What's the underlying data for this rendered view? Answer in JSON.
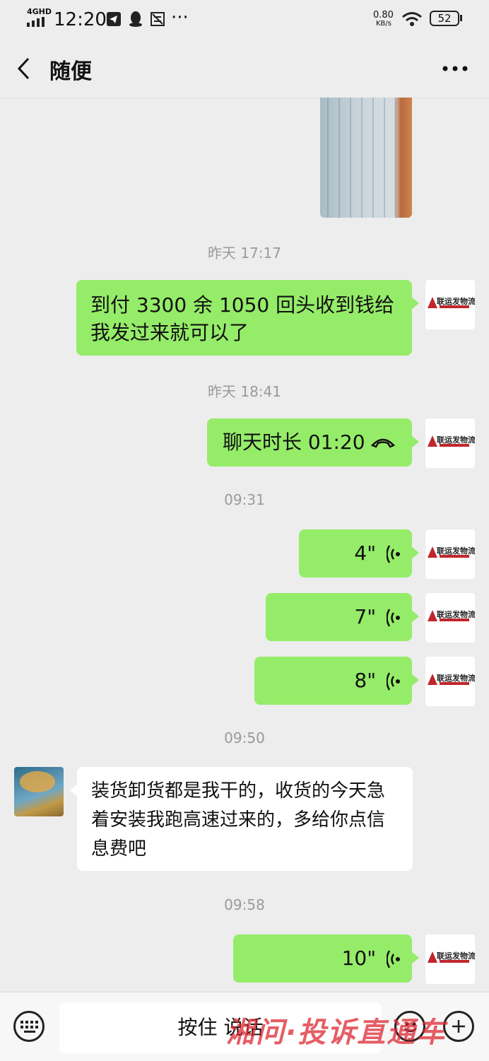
{
  "status_bar": {
    "network": "4GHD",
    "time": "12:20",
    "speed_value": "0.80",
    "speed_unit": "KB/s",
    "battery": "52"
  },
  "header": {
    "title": "随便"
  },
  "messages": {
    "ts1": "昨天 17:17",
    "text1": "到付 3300 余 1050 回头收到钱给我发过来就可以了",
    "ts2": "昨天 18:41",
    "call": "聊天时长 01:20",
    "ts3": "09:31",
    "voice1": "4\"",
    "voice2": "7\"",
    "voice3": "8\"",
    "ts4": "09:50",
    "text2": "装货卸货都是我干的，收货的今天急着安装我跑高速过来的，多给你点信息费吧",
    "ts5": "09:58",
    "voice4": "10\""
  },
  "logo": {
    "name": "联运发物流"
  },
  "input_bar": {
    "hold_to_talk": "按住 说话"
  },
  "watermark": "湘问·投诉直通车",
  "colors": {
    "sent_bubble": "#95ec69",
    "received_bubble": "#ffffff",
    "background": "#ededed",
    "logo_red": "#c0262c"
  }
}
